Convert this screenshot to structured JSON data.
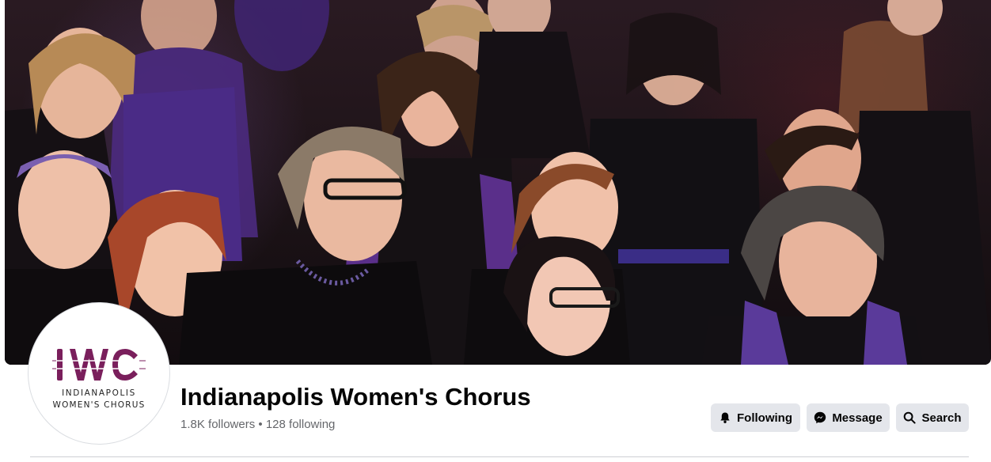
{
  "profile": {
    "name": "Indianapolis Women's Chorus",
    "followers": "1.8K followers",
    "separator": "•",
    "following_count": "128 following",
    "logo": {
      "mark": "IWC",
      "line1": "INDIANAPOLIS",
      "line2": "WOMEN'S CHORUS",
      "color": "#7a1f5c"
    }
  },
  "actions": {
    "following_label": "Following",
    "following_icon": "bell-icon",
    "message_label": "Message",
    "message_icon": "messenger-icon",
    "search_label": "Search",
    "search_icon": "search-icon"
  },
  "colors": {
    "button_bg": "#e4e6eb",
    "text_primary": "#050505",
    "text_secondary": "#65676b"
  }
}
